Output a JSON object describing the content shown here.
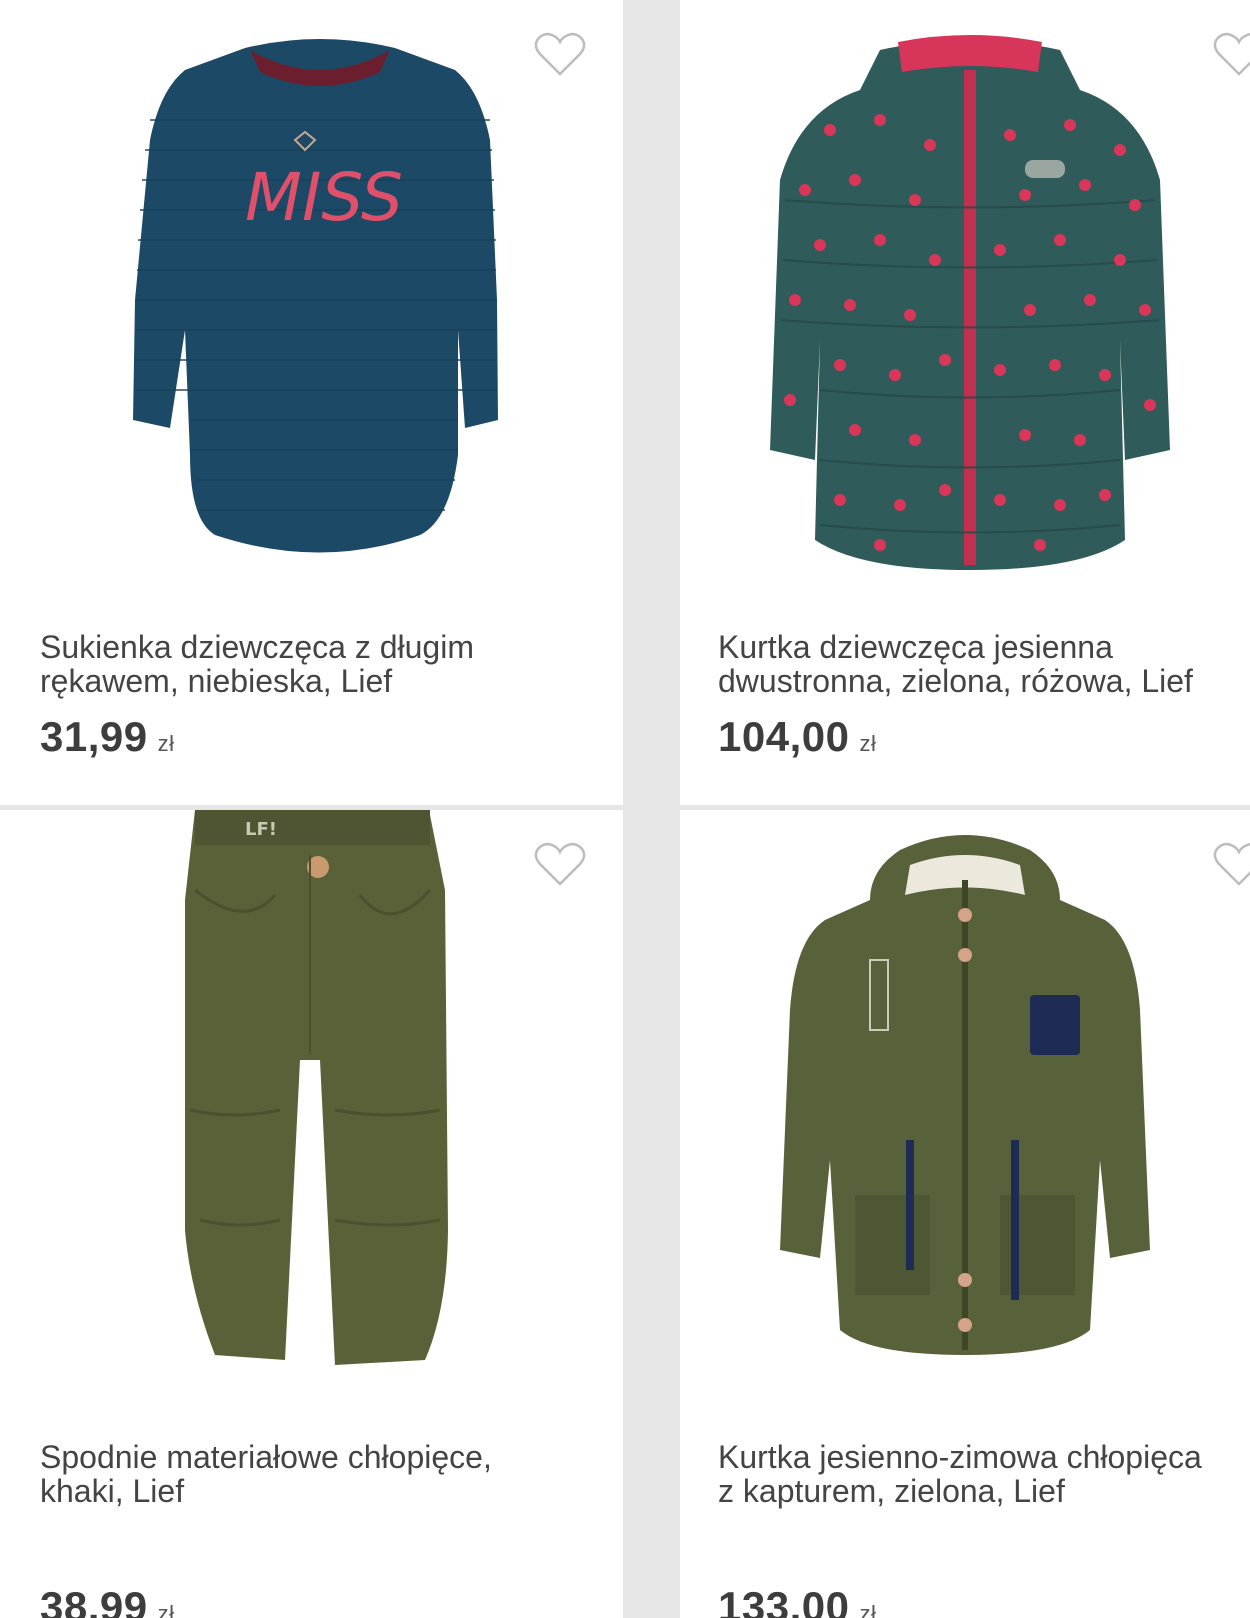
{
  "products": [
    {
      "title": "Sukienka dziewczęca z długim\nrękawem, niebieska, Lief",
      "price": "31,99",
      "currency": "zł",
      "image_icon": "blue-dress-image"
    },
    {
      "title": "Kurtka dziewczęca jesienna\ndwustronna, zielona, różowa, Lief",
      "price": "104,00",
      "currency": "zł",
      "image_icon": "polka-dot-jacket-image"
    },
    {
      "title": "Spodnie materiałowe chłopięce,\nkhaki, Lief",
      "price": "38,99",
      "currency": "zł",
      "image_icon": "khaki-pants-image"
    },
    {
      "title": "Kurtka jesienno-zimowa chłopięca\nz kapturem, zielona, Lief",
      "price": "133,00",
      "currency": "zł",
      "image_icon": "green-parka-image"
    }
  ],
  "colors": {
    "dress": "#1c4a66",
    "jacket_teal": "#2f5b5a",
    "jacket_dots": "#d9365a",
    "khaki": "#5a6138",
    "parka": "#57623a"
  }
}
